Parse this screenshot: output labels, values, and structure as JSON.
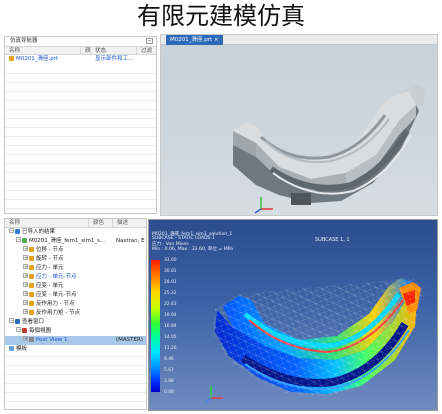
{
  "title": "有限元建模仿真",
  "navigator": {
    "title": "仿真导航器",
    "columns": [
      "名称",
      "颜",
      "状态",
      "过滤"
    ],
    "rows": [
      {
        "name": "M0201_滑座.prt",
        "status": "显示部件和工..."
      }
    ]
  },
  "results": {
    "columns": [
      "名称",
      "颜色",
      "描述"
    ],
    "items": [
      {
        "label": "已导入的结果",
        "desc": "",
        "indent": 0,
        "sign": "−"
      },
      {
        "label": "M0201_滑座_fem1_sim1_s...",
        "desc": "Nastran, E",
        "indent": 1,
        "sign": "−"
      },
      {
        "label": "位移 - 节点",
        "desc": "",
        "indent": 2,
        "sign": "+"
      },
      {
        "label": "旋转 - 节点",
        "desc": "",
        "indent": 2,
        "sign": "+"
      },
      {
        "label": "应力 - 单元",
        "desc": "",
        "indent": 2,
        "sign": "+"
      },
      {
        "label": "应力 - 单元-节点",
        "desc": "",
        "indent": 2,
        "sign": "+",
        "blue": true
      },
      {
        "label": "应变 - 单元",
        "desc": "",
        "indent": 2,
        "sign": "+"
      },
      {
        "label": "应变 - 单元-节点",
        "desc": "",
        "indent": 2,
        "sign": "+"
      },
      {
        "label": "反作用力 - 节点",
        "desc": "",
        "indent": 2,
        "sign": "+"
      },
      {
        "label": "反作用力矩 - 节点",
        "desc": "",
        "indent": 2,
        "sign": "+"
      },
      {
        "label": "查看窗口",
        "desc": "",
        "indent": 0,
        "sign": "−"
      },
      {
        "label": "每個視圖",
        "desc": "",
        "indent": 1,
        "sign": "−"
      },
      {
        "label": "Post View 1",
        "desc": "(MASTER)",
        "indent": 2,
        "sign": "+",
        "selected": true,
        "blue": true
      },
      {
        "label": "模板",
        "desc": "",
        "indent": 0,
        "sign": ""
      }
    ]
  },
  "viewport_top": {
    "tab_label": "M0201_滑座.prt ×"
  },
  "viewport_bottom": {
    "header_line1": "M0201_滑座_fem1_sim1_solution_1",
    "header_line2": "SUBCASE - STATIC LOADS 1",
    "header_line3": "应力 - Von Mises",
    "header_line4": "Min : 0.06,  Max : 33.60,  单位 = MPa",
    "subcase": "SUBCASE 1, 1",
    "legend_values": [
      "33.60",
      "30.81",
      "28.01",
      "25.22",
      "22.43",
      "19.64",
      "16.84",
      "14.05",
      "11.26",
      "8.46",
      "5.67",
      "2.88",
      "0.08"
    ]
  },
  "colors": {
    "accent": "#2d6bb8",
    "selected_row": "#a7c8e8"
  }
}
